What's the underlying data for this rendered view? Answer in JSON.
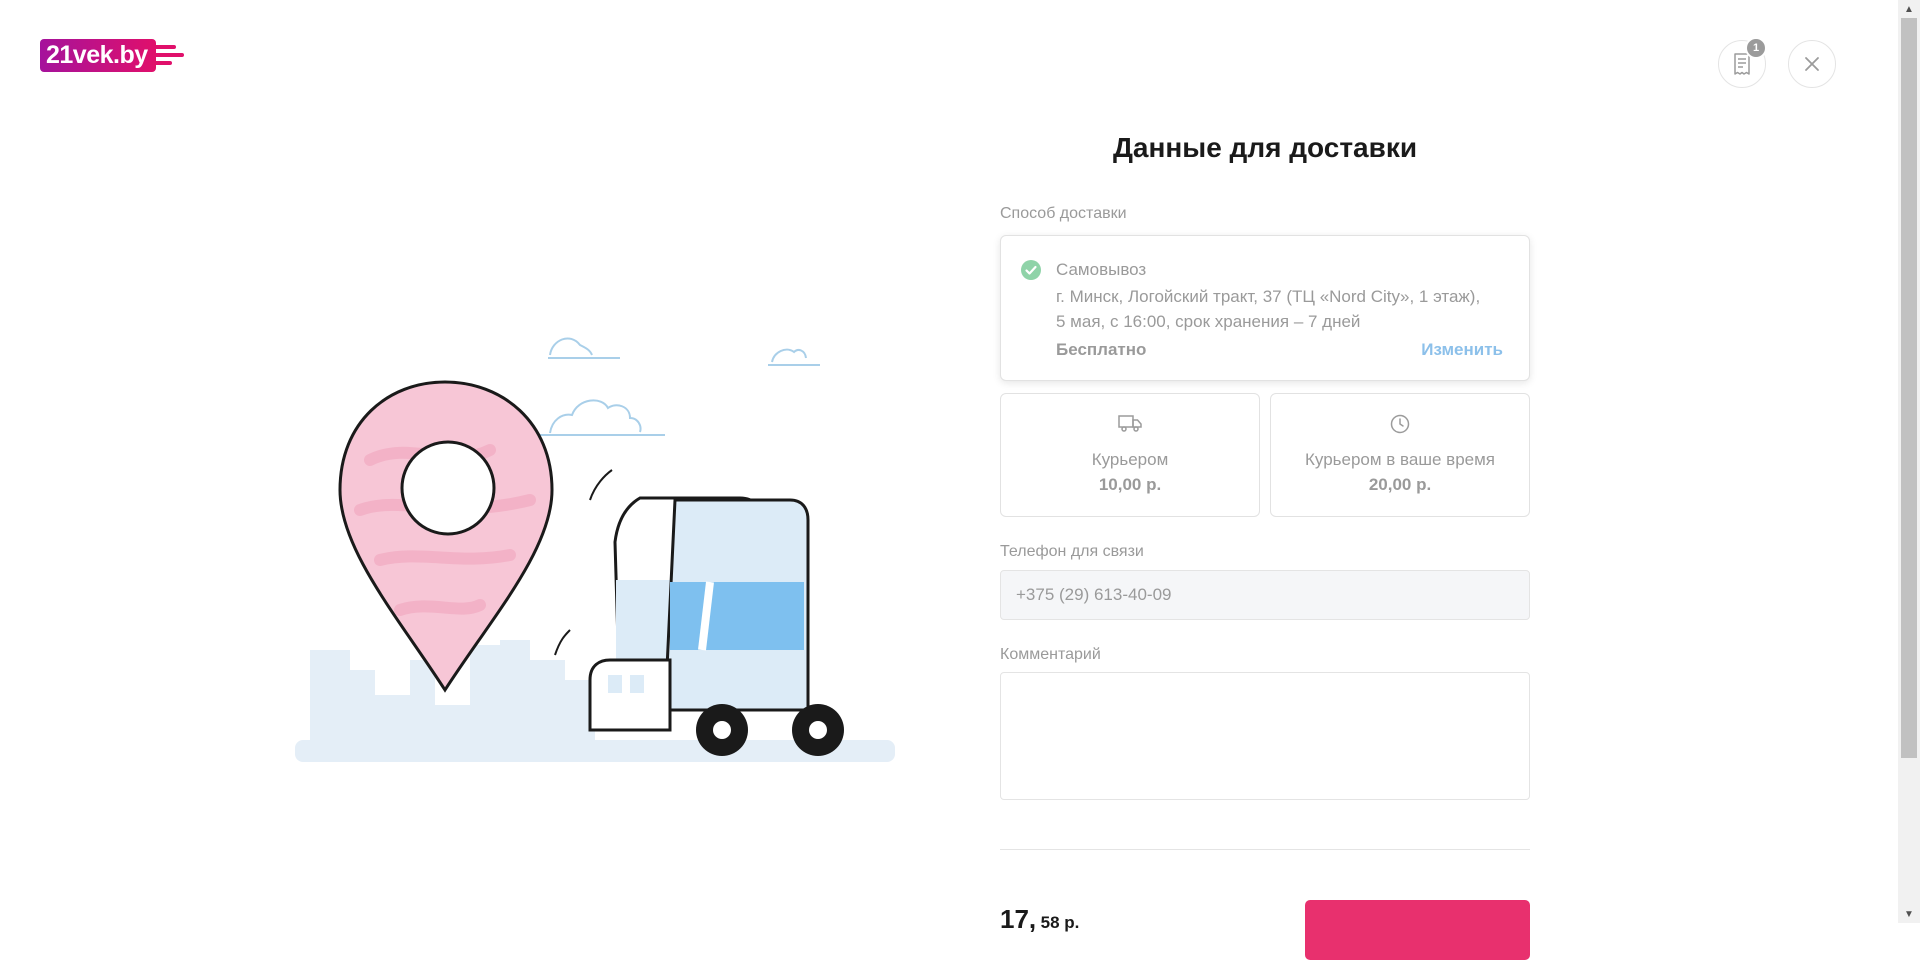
{
  "header": {
    "logo_text": "21vek.by",
    "receipt_badge_count": "1"
  },
  "form": {
    "title": "Данные для доставки",
    "delivery_method_label": "Способ доставки",
    "selected_option": {
      "name": "Самовывоз",
      "address_line1": "г. Минск, Логойский тракт, 37 (ТЦ «Nord City», 1 этаж),",
      "address_line2": "5 мая, с 16:00, срок хранения – 7 дней",
      "price": "Бесплатно",
      "change_label": "Изменить"
    },
    "options": [
      {
        "name": "Курьером",
        "price": "10,00 р.",
        "icon": "truck-icon"
      },
      {
        "name": "Курьером в ваше время",
        "price": "20,00 р.",
        "icon": "clock-icon"
      }
    ],
    "phone_label": "Телефон для связи",
    "phone_value": "+375 (29) 613-40-09",
    "comment_label": "Комментарий",
    "comment_value": "",
    "total_main": "17,",
    "total_sub": "58 р."
  },
  "colors": {
    "brand_pink": "#e8306e",
    "brand_purple": "#a5129c",
    "link_blue": "#8cc0ea",
    "check_green": "#8fd3a8"
  }
}
